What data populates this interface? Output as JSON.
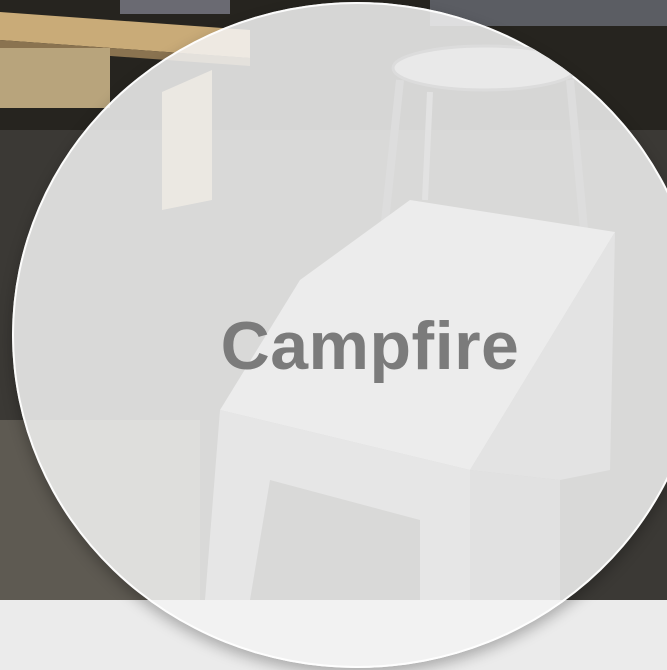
{
  "card": {
    "title": "Campfire"
  },
  "colors": {
    "overlay": "#f3f3f3",
    "title": "#7b7b7b",
    "bottom_strip": "#ebebeb",
    "floor_dark": "#2f2d2a"
  }
}
